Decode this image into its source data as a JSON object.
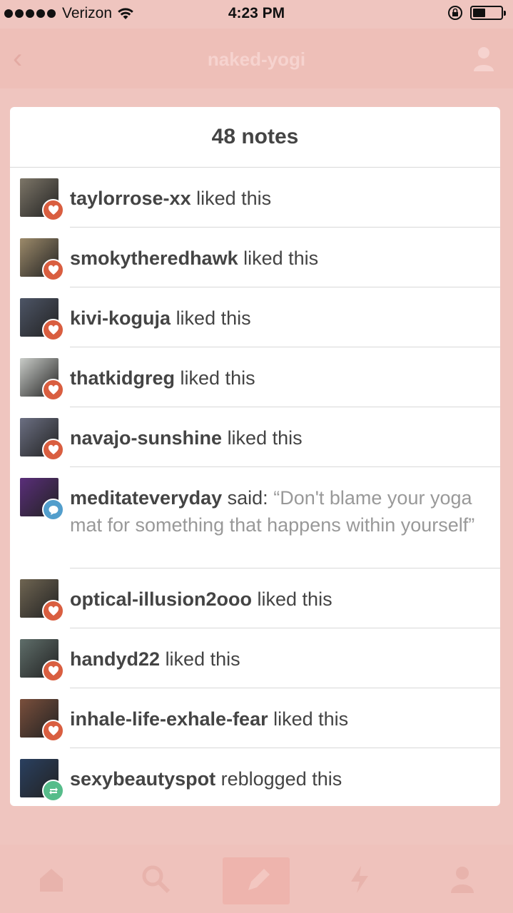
{
  "status_bar": {
    "carrier": "Verizon",
    "time": "4:23 PM",
    "battery_level": 0.45
  },
  "background_nav": {
    "title": "naked-yogi"
  },
  "notes_panel": {
    "title": "48 notes",
    "notes": [
      {
        "user": "taylorrose-xx",
        "action": "liked this",
        "type": "like",
        "avatar_color": "#7d7668"
      },
      {
        "user": "smokytheredhawk",
        "action": "liked this",
        "type": "like",
        "avatar_color": "#9c8a6a"
      },
      {
        "user": "kivi-koguja",
        "action": "liked this",
        "type": "like",
        "avatar_color": "#4d5566"
      },
      {
        "user": "thatkidgreg",
        "action": "liked this",
        "type": "like",
        "avatar_color": "#c9ccc8"
      },
      {
        "user": "navajo-sunshine",
        "action": "liked this",
        "type": "like",
        "avatar_color": "#6b6f82"
      },
      {
        "user": "meditateveryday",
        "action": "said:",
        "quote": "“Don't blame your yoga mat for something that happens within yourself”",
        "type": "comment",
        "avatar_color": "#5a2e7a"
      },
      {
        "user": "optical-illusion2ooo",
        "action": "liked this",
        "type": "like",
        "avatar_color": "#6f6552"
      },
      {
        "user": "handyd22",
        "action": "liked this",
        "type": "like",
        "avatar_color": "#5f6e6a"
      },
      {
        "user": "inhale-life-exhale-fear",
        "action": "liked this",
        "type": "like",
        "avatar_color": "#7a4f3c"
      },
      {
        "user": "sexybeautyspot",
        "action": "reblogged this",
        "type": "reblog",
        "avatar_color": "#2a4060"
      }
    ]
  },
  "colors": {
    "like": "#d95e40",
    "comment": "#529ecc",
    "reblog": "#56bc8a",
    "overlay": "#efc5bf"
  }
}
